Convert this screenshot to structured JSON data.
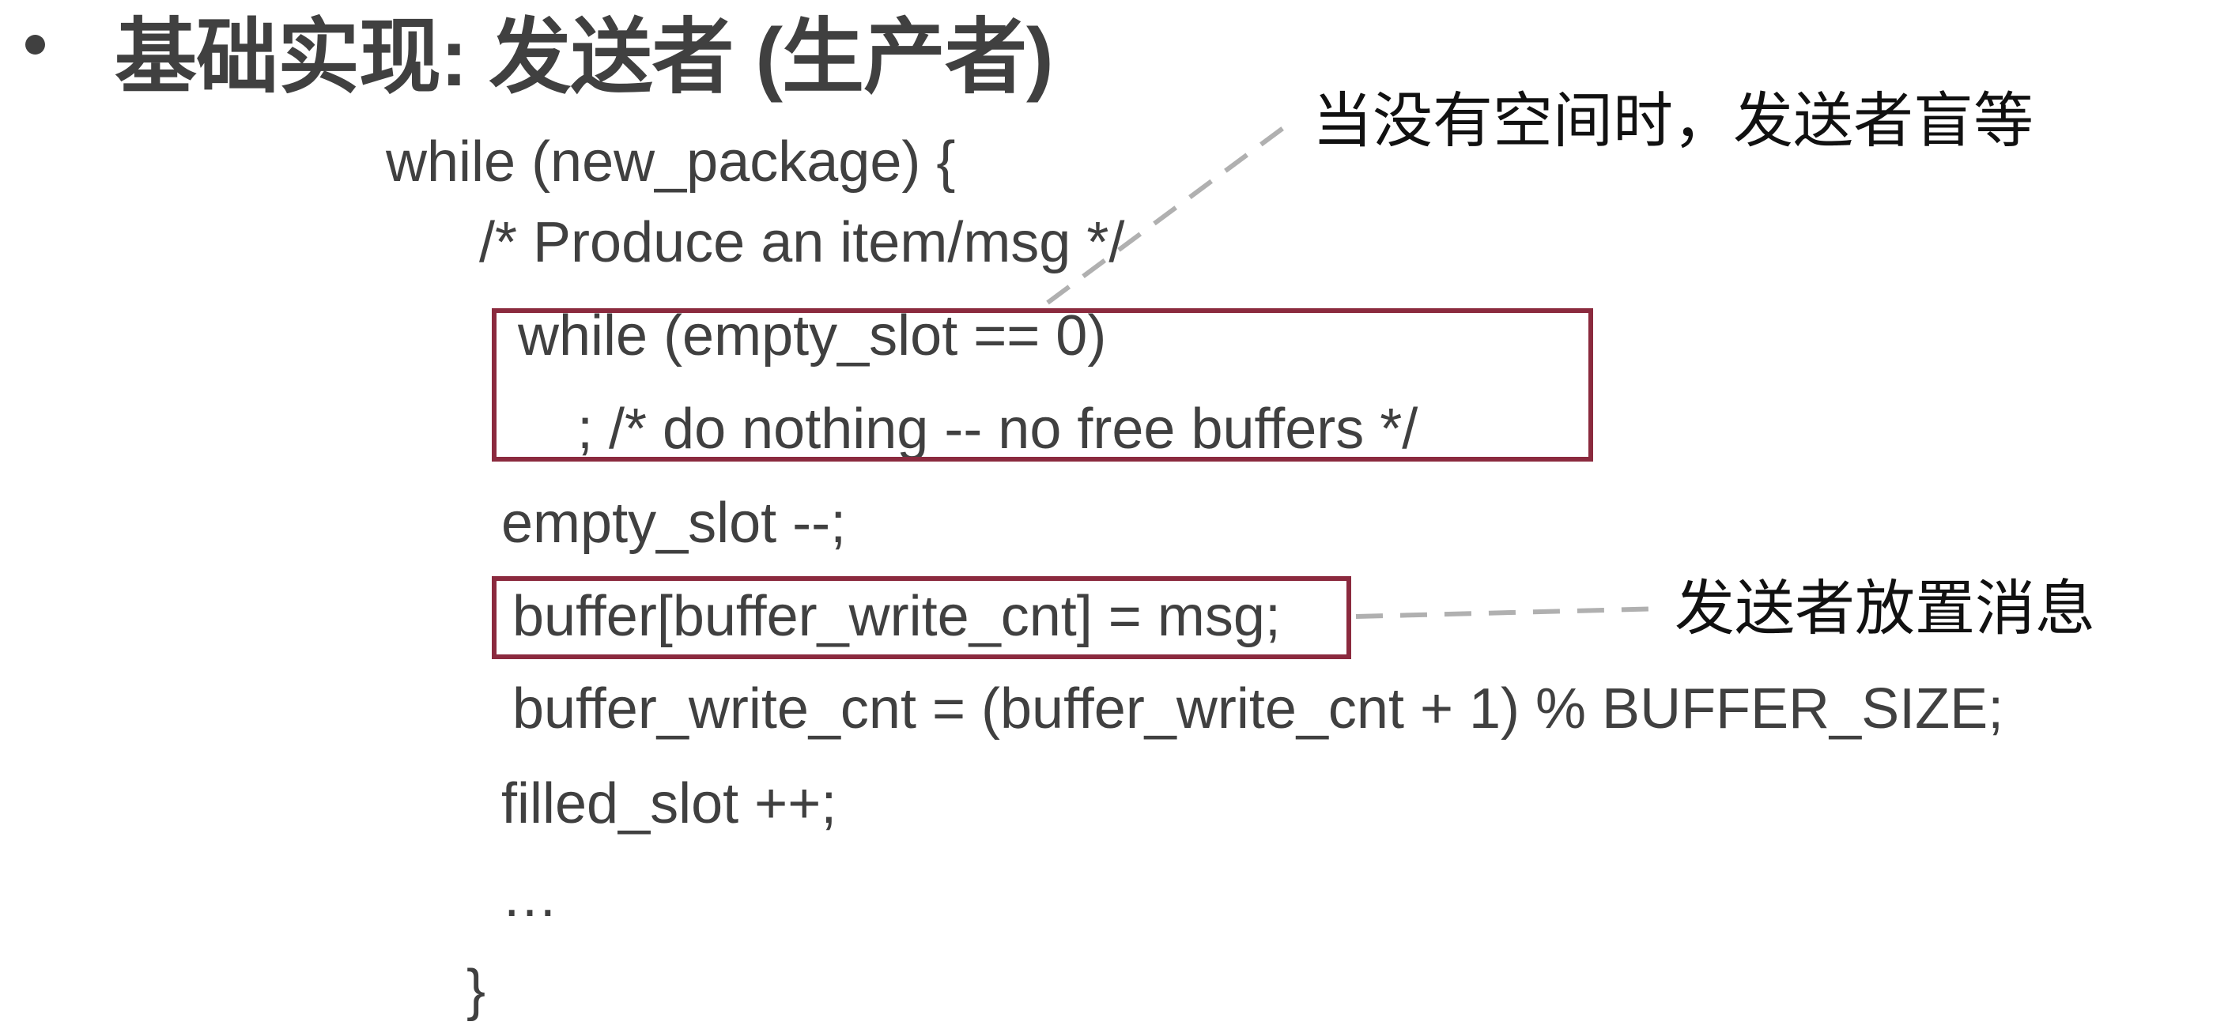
{
  "slide": {
    "title": "基础实现: 发送者 (生产者)",
    "code_lines": [
      "while (new_package) {",
      "/* Produce an item/msg */",
      "while (empty_slot == 0)",
      ";   /* do nothing -- no free buffers */",
      "empty_slot --;",
      "buffer[buffer_write_cnt] = msg;",
      "buffer_write_cnt = (buffer_write_cnt + 1) % BUFFER_SIZE;",
      "filled_slot ++;",
      "…",
      "}"
    ],
    "annotations": [
      "当没有空间时，发送者盲等",
      "发送者放置消息"
    ]
  },
  "colors": {
    "text": "#404040",
    "highlight_box": "#8b2a3e",
    "leader_line": "#b0b0b0"
  }
}
